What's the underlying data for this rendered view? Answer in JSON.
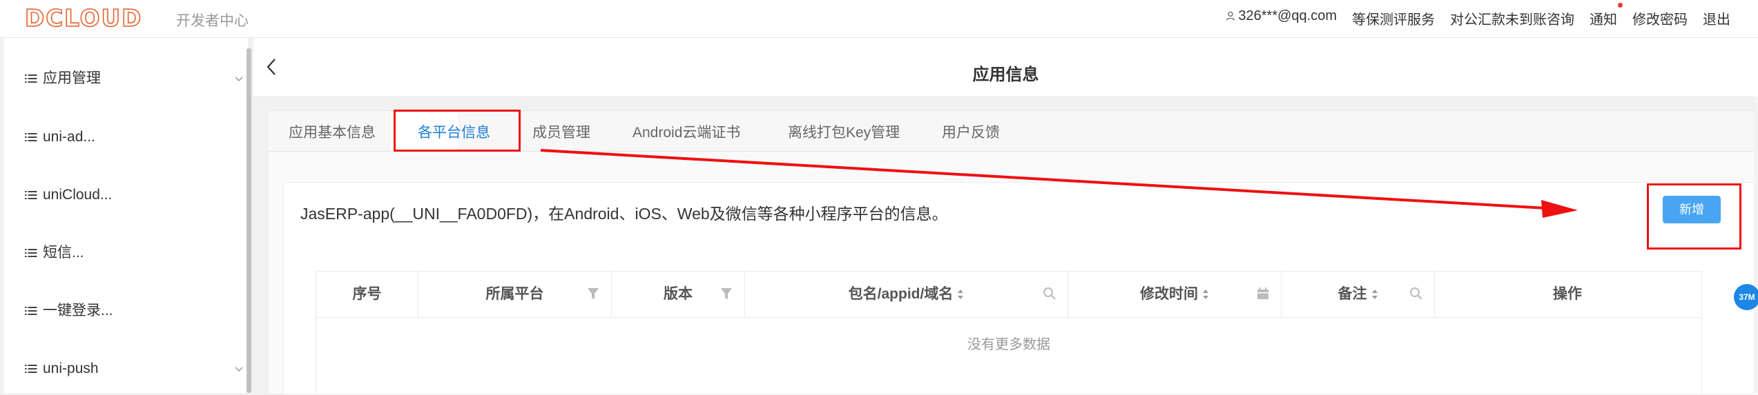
{
  "header": {
    "logo_text": "DCLOUD",
    "logo_sub": "开发者中心",
    "user": "326***@qq.com",
    "links": [
      "等保测评服务",
      "对公汇款未到账咨询",
      "通知",
      "修改密码",
      "退出"
    ]
  },
  "sidebar": {
    "items": [
      {
        "label": "应用管理",
        "expandable": true
      },
      {
        "label": "uni-ad...",
        "expandable": false
      },
      {
        "label": "uniCloud...",
        "expandable": false
      },
      {
        "label": "短信...",
        "expandable": false
      },
      {
        "label": "一键登录...",
        "expandable": false
      },
      {
        "label": "uni-push",
        "expandable": true
      }
    ]
  },
  "page": {
    "title": "应用信息"
  },
  "tabs": [
    {
      "label": "应用基本信息",
      "active": false
    },
    {
      "label": "各平台信息",
      "active": true
    },
    {
      "label": "成员管理",
      "active": false
    },
    {
      "label": "Android云端证书",
      "active": false
    },
    {
      "label": "离线打包Key管理",
      "active": false
    },
    {
      "label": "用户反馈",
      "active": false
    }
  ],
  "panel": {
    "description": "JasERP-app(__UNI__FA0D0FD)，在Android、iOS、Web及微信等各种小程序平台的信息。",
    "add_button": "新增"
  },
  "table": {
    "columns": [
      "序号",
      "所属平台",
      "版本",
      "包名/appid/域名",
      "修改时间",
      "备注",
      "操作"
    ],
    "empty_text": "没有更多数据"
  },
  "floating_badge": "37M",
  "colors": {
    "accent": "#1e7ed8",
    "button": "#48a5f3",
    "annotation": "#e11111",
    "logo": "#e8602c"
  }
}
